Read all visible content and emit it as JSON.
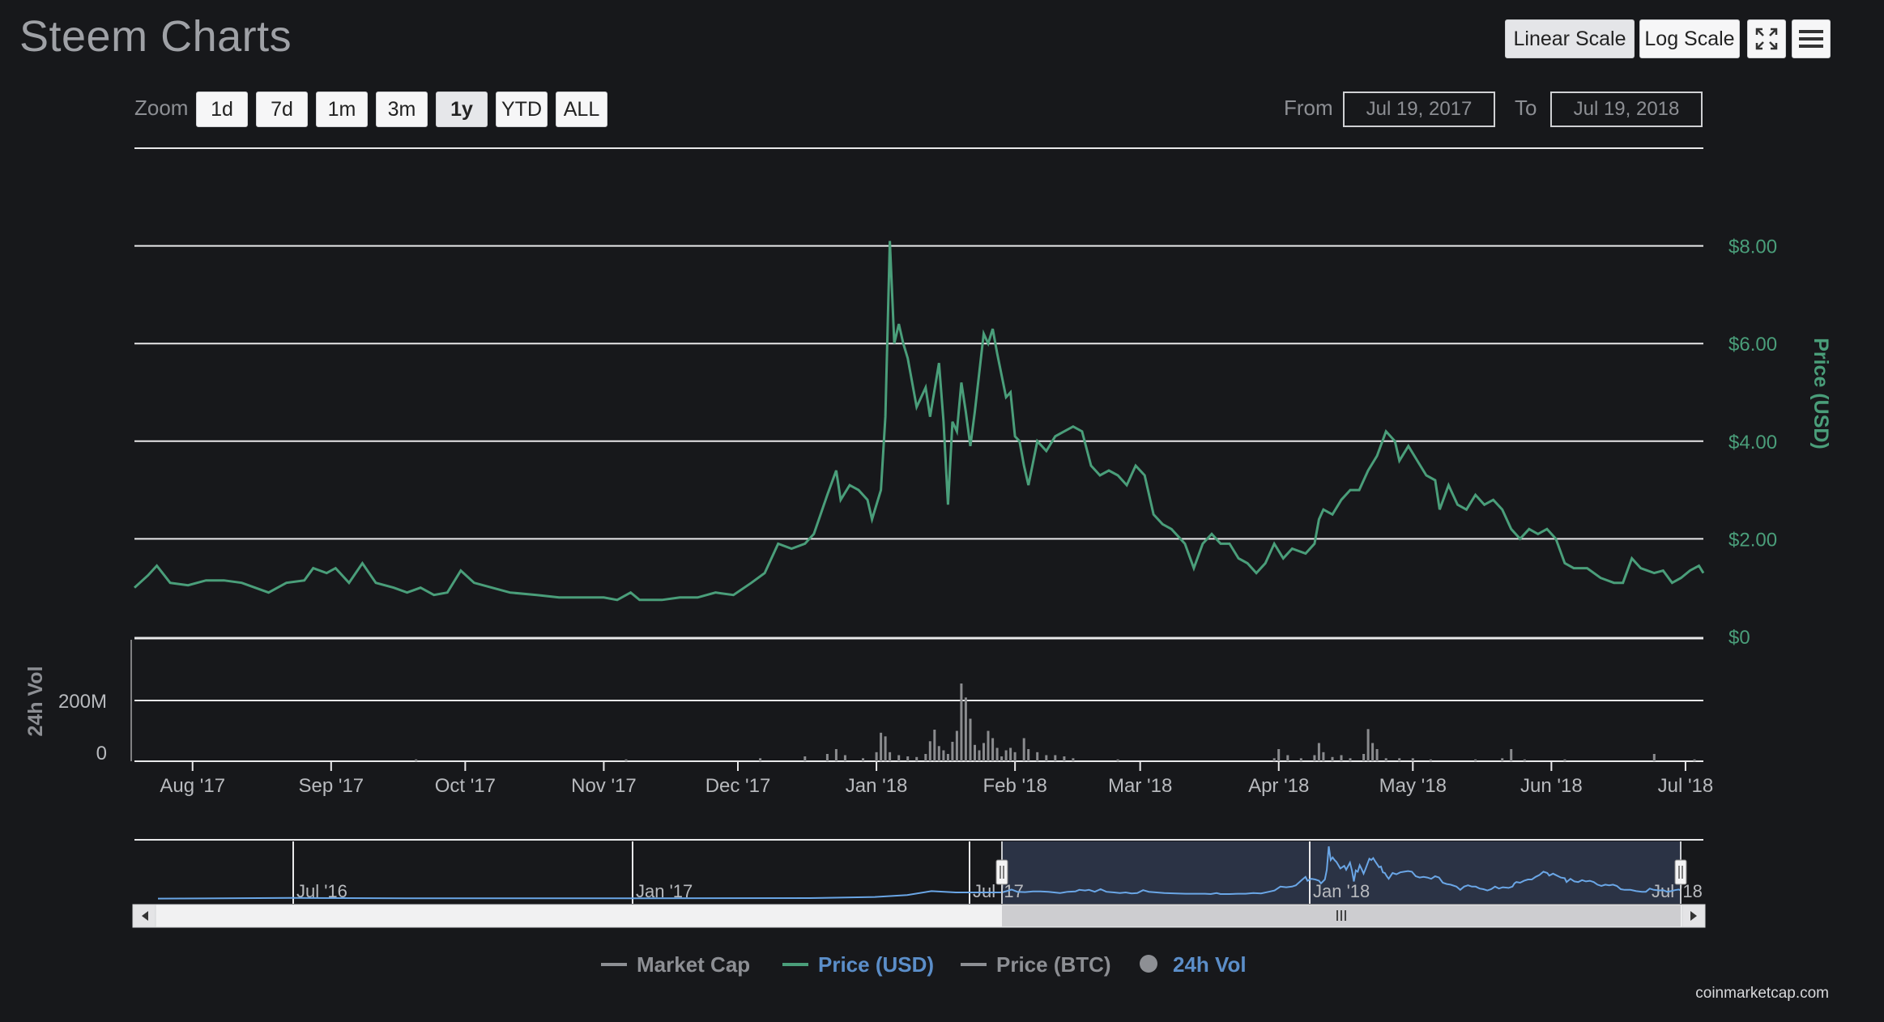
{
  "header": {
    "title": "Steem Charts",
    "linear_scale": "Linear Scale",
    "log_scale": "Log Scale",
    "fullscreen_icon": "fullscreen-icon",
    "menu_icon": "hamburger-menu-icon"
  },
  "zoom": {
    "label": "Zoom",
    "buttons": [
      "1d",
      "7d",
      "1m",
      "3m",
      "1y",
      "YTD",
      "ALL"
    ],
    "active": "1y"
  },
  "range": {
    "from_label": "From",
    "from_value": "Jul 19, 2017",
    "to_label": "To",
    "to_value": "Jul 19, 2018"
  },
  "legend": {
    "items": [
      {
        "label": "Market Cap",
        "color": "#8d8f94",
        "active": false
      },
      {
        "label": "Price (USD)",
        "color": "#4a9e7a",
        "active": true
      },
      {
        "label": "Price (BTC)",
        "color": "#8d8f94",
        "active": false
      },
      {
        "label": "24h Vol",
        "color": "#5b8ec9",
        "active": true
      }
    ]
  },
  "credit": "coinmarketcap.com",
  "chart_data": {
    "type": "line",
    "xlabel": "",
    "ylabel": "Price (USD)",
    "price_axis": {
      "ticks": [
        {
          "value": 0,
          "label": "$0"
        },
        {
          "value": 2,
          "label": "$2.00"
        },
        {
          "value": 4,
          "label": "$4.00"
        },
        {
          "value": 6,
          "label": "$6.00"
        },
        {
          "value": 8,
          "label": "$8.00"
        }
      ],
      "ylim": [
        0,
        10
      ]
    },
    "volume_axis": {
      "label": "24h Vol",
      "ticks": [
        {
          "value": 0,
          "label": "0"
        },
        {
          "value": 200,
          "label": "200M"
        }
      ],
      "ylim": [
        0,
        400
      ]
    },
    "x_ticks": [
      "Aug '17",
      "Sep '17",
      "Oct '17",
      "Nov '17",
      "Dec '17",
      "Jan '18",
      "Feb '18",
      "Mar '18",
      "Apr '18",
      "May '18",
      "Jun '18",
      "Jul '18"
    ],
    "x_tick_days": [
      13,
      44,
      74,
      105,
      135,
      166,
      197,
      225,
      256,
      286,
      317,
      347
    ],
    "grid": true,
    "series": [
      {
        "name": "Price (USD)",
        "color": "#4a9e7a",
        "points": [
          [
            0,
            1.0
          ],
          [
            3,
            1.25
          ],
          [
            5,
            1.45
          ],
          [
            8,
            1.1
          ],
          [
            12,
            1.05
          ],
          [
            16,
            1.15
          ],
          [
            20,
            1.15
          ],
          [
            24,
            1.1
          ],
          [
            27,
            1.0
          ],
          [
            30,
            0.9
          ],
          [
            32,
            1.0
          ],
          [
            34,
            1.1
          ],
          [
            38,
            1.15
          ],
          [
            40,
            1.4
          ],
          [
            43,
            1.3
          ],
          [
            45,
            1.4
          ],
          [
            48,
            1.1
          ],
          [
            51,
            1.5
          ],
          [
            54,
            1.1
          ],
          [
            58,
            1.0
          ],
          [
            61,
            0.9
          ],
          [
            64,
            1.0
          ],
          [
            67,
            0.85
          ],
          [
            70,
            0.9
          ],
          [
            73,
            1.35
          ],
          [
            76,
            1.1
          ],
          [
            80,
            1.0
          ],
          [
            84,
            0.9
          ],
          [
            90,
            0.85
          ],
          [
            95,
            0.8
          ],
          [
            100,
            0.8
          ],
          [
            105,
            0.8
          ],
          [
            108,
            0.75
          ],
          [
            111,
            0.9
          ],
          [
            113,
            0.75
          ],
          [
            118,
            0.75
          ],
          [
            122,
            0.8
          ],
          [
            126,
            0.8
          ],
          [
            130,
            0.9
          ],
          [
            134,
            0.85
          ],
          [
            138,
            1.1
          ],
          [
            141,
            1.3
          ],
          [
            144,
            1.9
          ],
          [
            147,
            1.8
          ],
          [
            150,
            1.9
          ],
          [
            152,
            2.1
          ],
          [
            155,
            2.9
          ],
          [
            157,
            3.4
          ],
          [
            158,
            2.8
          ],
          [
            160,
            3.1
          ],
          [
            162,
            3.0
          ],
          [
            164,
            2.8
          ],
          [
            165,
            2.4
          ],
          [
            167,
            3.0
          ],
          [
            168,
            4.5
          ],
          [
            169,
            8.1
          ],
          [
            170,
            6.0
          ],
          [
            171,
            6.4
          ],
          [
            172,
            6.0
          ],
          [
            173,
            5.7
          ],
          [
            175,
            4.7
          ],
          [
            177,
            5.1
          ],
          [
            178,
            4.5
          ],
          [
            180,
            5.6
          ],
          [
            181,
            4.4
          ],
          [
            182,
            2.7
          ],
          [
            183,
            4.4
          ],
          [
            184,
            4.2
          ],
          [
            185,
            5.2
          ],
          [
            186,
            4.6
          ],
          [
            187,
            3.9
          ],
          [
            188,
            4.6
          ],
          [
            190,
            6.2
          ],
          [
            191,
            6.0
          ],
          [
            192,
            6.3
          ],
          [
            193,
            5.8
          ],
          [
            195,
            4.9
          ],
          [
            196,
            5.0
          ],
          [
            197,
            4.1
          ],
          [
            198,
            4.0
          ],
          [
            199,
            3.5
          ],
          [
            200,
            3.1
          ],
          [
            202,
            4.0
          ],
          [
            204,
            3.8
          ],
          [
            206,
            4.1
          ],
          [
            208,
            4.2
          ],
          [
            210,
            4.3
          ],
          [
            212,
            4.2
          ],
          [
            214,
            3.5
          ],
          [
            216,
            3.3
          ],
          [
            218,
            3.4
          ],
          [
            220,
            3.3
          ],
          [
            222,
            3.1
          ],
          [
            224,
            3.5
          ],
          [
            226,
            3.3
          ],
          [
            228,
            2.5
          ],
          [
            230,
            2.3
          ],
          [
            232,
            2.2
          ],
          [
            235,
            1.9
          ],
          [
            237,
            1.4
          ],
          [
            239,
            1.9
          ],
          [
            241,
            2.1
          ],
          [
            243,
            1.9
          ],
          [
            245,
            1.9
          ],
          [
            247,
            1.6
          ],
          [
            249,
            1.5
          ],
          [
            251,
            1.3
          ],
          [
            253,
            1.5
          ],
          [
            255,
            1.9
          ],
          [
            257,
            1.6
          ],
          [
            259,
            1.8
          ],
          [
            262,
            1.7
          ],
          [
            264,
            1.9
          ],
          [
            265,
            2.4
          ],
          [
            266,
            2.6
          ],
          [
            268,
            2.5
          ],
          [
            270,
            2.8
          ],
          [
            272,
            3.0
          ],
          [
            274,
            3.0
          ],
          [
            276,
            3.4
          ],
          [
            278,
            3.7
          ],
          [
            280,
            4.2
          ],
          [
            282,
            4.0
          ],
          [
            283,
            3.6
          ],
          [
            285,
            3.9
          ],
          [
            287,
            3.6
          ],
          [
            289,
            3.3
          ],
          [
            291,
            3.2
          ],
          [
            292,
            2.6
          ],
          [
            294,
            3.1
          ],
          [
            296,
            2.7
          ],
          [
            298,
            2.6
          ],
          [
            300,
            2.9
          ],
          [
            302,
            2.7
          ],
          [
            304,
            2.8
          ],
          [
            306,
            2.6
          ],
          [
            308,
            2.2
          ],
          [
            310,
            2.0
          ],
          [
            312,
            2.2
          ],
          [
            314,
            2.1
          ],
          [
            316,
            2.2
          ],
          [
            318,
            2.0
          ],
          [
            320,
            1.5
          ],
          [
            322,
            1.4
          ],
          [
            325,
            1.4
          ],
          [
            328,
            1.2
          ],
          [
            331,
            1.1
          ],
          [
            333,
            1.1
          ],
          [
            335,
            1.6
          ],
          [
            337,
            1.4
          ],
          [
            340,
            1.3
          ],
          [
            342,
            1.35
          ],
          [
            344,
            1.1
          ],
          [
            346,
            1.2
          ],
          [
            348,
            1.35
          ],
          [
            350,
            1.45
          ],
          [
            351,
            1.3
          ]
        ]
      },
      {
        "name": "24h Vol",
        "color": "#8a8b8e",
        "type": "bar",
        "bars": [
          [
            63,
            6
          ],
          [
            110,
            6
          ],
          [
            140,
            10
          ],
          [
            150,
            16
          ],
          [
            155,
            24
          ],
          [
            157,
            40
          ],
          [
            159,
            20
          ],
          [
            163,
            10
          ],
          [
            166,
            30
          ],
          [
            167,
            94
          ],
          [
            168,
            82
          ],
          [
            169,
            30
          ],
          [
            171,
            20
          ],
          [
            173,
            16
          ],
          [
            175,
            14
          ],
          [
            177,
            24
          ],
          [
            178,
            66
          ],
          [
            179,
            104
          ],
          [
            180,
            50
          ],
          [
            181,
            36
          ],
          [
            182,
            24
          ],
          [
            183,
            64
          ],
          [
            184,
            100
          ],
          [
            185,
            256
          ],
          [
            186,
            210
          ],
          [
            187,
            140
          ],
          [
            188,
            54
          ],
          [
            189,
            36
          ],
          [
            190,
            60
          ],
          [
            191,
            100
          ],
          [
            192,
            76
          ],
          [
            193,
            44
          ],
          [
            194,
            16
          ],
          [
            195,
            36
          ],
          [
            196,
            44
          ],
          [
            197,
            30
          ],
          [
            199,
            76
          ],
          [
            200,
            40
          ],
          [
            202,
            30
          ],
          [
            204,
            20
          ],
          [
            206,
            20
          ],
          [
            208,
            16
          ],
          [
            210,
            10
          ],
          [
            220,
            6
          ],
          [
            255,
            10
          ],
          [
            256,
            40
          ],
          [
            258,
            20
          ],
          [
            261,
            10
          ],
          [
            264,
            20
          ],
          [
            265,
            60
          ],
          [
            266,
            30
          ],
          [
            268,
            14
          ],
          [
            270,
            20
          ],
          [
            272,
            10
          ],
          [
            275,
            24
          ],
          [
            276,
            106
          ],
          [
            277,
            60
          ],
          [
            278,
            40
          ],
          [
            280,
            10
          ],
          [
            283,
            10
          ],
          [
            286,
            10
          ],
          [
            290,
            6
          ],
          [
            300,
            6
          ],
          [
            306,
            10
          ],
          [
            308,
            40
          ],
          [
            311,
            6
          ],
          [
            320,
            6
          ],
          [
            340,
            24
          ],
          [
            349,
            6
          ]
        ]
      }
    ],
    "navigator": {
      "tick_labels": [
        "Jul '16",
        "Jan '17",
        "Jul '17",
        "Jan '18",
        "Jul '18"
      ],
      "color": "#6aa6e6"
    }
  }
}
